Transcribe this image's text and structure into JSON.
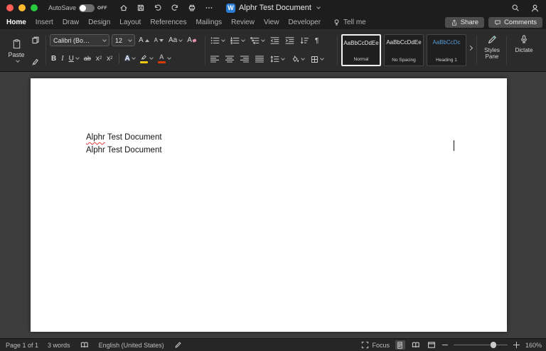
{
  "titlebar": {
    "autosave_label": "AutoSave",
    "autosave_state": "OFF",
    "app_icon_letter": "W",
    "doc_title": "Alphr Test Document"
  },
  "tabbar": {
    "tabs": [
      {
        "label": "Home",
        "active": true
      },
      {
        "label": "Insert"
      },
      {
        "label": "Draw"
      },
      {
        "label": "Design"
      },
      {
        "label": "Layout"
      },
      {
        "label": "References"
      },
      {
        "label": "Mailings"
      },
      {
        "label": "Review"
      },
      {
        "label": "View"
      },
      {
        "label": "Developer"
      }
    ],
    "tellme_label": "Tell me",
    "share_label": "Share",
    "comments_label": "Comments"
  },
  "ribbon": {
    "paste_label": "Paste",
    "font_name": "Calibri (Bo…",
    "font_size": "12",
    "grow_font": "A",
    "shrink_font": "A",
    "change_case": "Aa",
    "clear_format": "A",
    "bold": "B",
    "italic": "I",
    "underline": "U",
    "strikethrough": "ab",
    "script_base": "x",
    "script_num": "2",
    "text_effects": "A",
    "font_color": "A",
    "pilcrow": "¶",
    "styles": [
      {
        "sample": "AaBbCcDdEe",
        "label": "Normal",
        "selected": true
      },
      {
        "sample": "AaBbCcDdEe",
        "label": "No Spacing",
        "selected": false
      },
      {
        "sample": "AaBbCcDc",
        "label": "Heading 1",
        "selected": false
      }
    ],
    "styles_pane_label": "Styles Pane",
    "dictate_label": "Dictate"
  },
  "document": {
    "line1_flagged": "Alphr",
    "line1_rest": " Test Document",
    "line2": "Alphr Test Document"
  },
  "statusbar": {
    "page_info": "Page 1 of 1",
    "word_count": "3 words",
    "language": "English (United States)",
    "focus_label": "Focus",
    "zoom_level": "160%"
  },
  "colors": {
    "accent_blue": "#2b7cd3",
    "heading_blue": "#569cd6",
    "highlight_yellow": "#f2c811",
    "font_color_red": "#d83b01",
    "spellcheck_red": "#e53935",
    "traffic_red": "#ff5f57",
    "traffic_yellow": "#febc2e",
    "traffic_green": "#28c840"
  }
}
